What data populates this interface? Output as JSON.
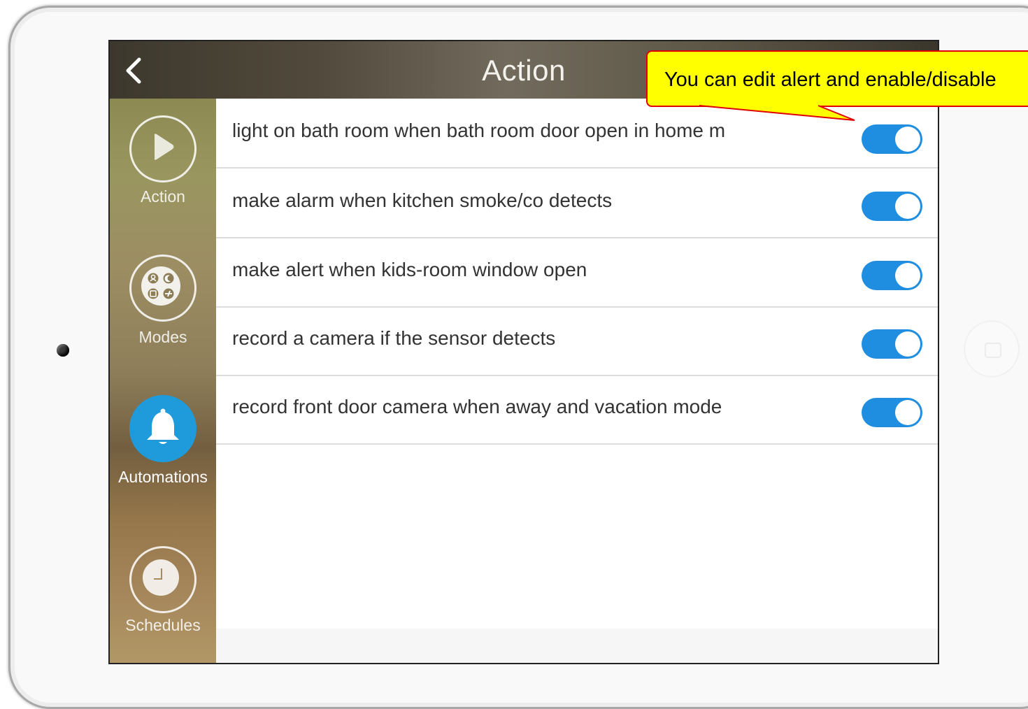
{
  "header": {
    "title": "Action"
  },
  "sidebar": {
    "items": [
      {
        "label": "Action",
        "icon": "play-icon",
        "active": false
      },
      {
        "label": "Modes",
        "icon": "modes-icon",
        "active": false
      },
      {
        "label": "Automations",
        "icon": "bell-icon",
        "active": true
      },
      {
        "label": "Schedules",
        "icon": "clock-icon",
        "active": false
      }
    ]
  },
  "automations": [
    {
      "text": "light on bath room when bath room door open in home m",
      "enabled": true
    },
    {
      "text": "make alarm when kitchen smoke/co detects",
      "enabled": true
    },
    {
      "text": "make alert when kids-room window open",
      "enabled": true
    },
    {
      "text": "record a camera if the sensor detects",
      "enabled": true
    },
    {
      "text": "record front door camera when away and vacation mode",
      "enabled": true
    }
  ],
  "callout": {
    "text": "You can edit alert and enable/disable"
  },
  "colors": {
    "accent": "#1f9bdc",
    "toggle_on": "#1f8ee0",
    "callout_bg": "#ffff00",
    "callout_border": "#e00000"
  }
}
